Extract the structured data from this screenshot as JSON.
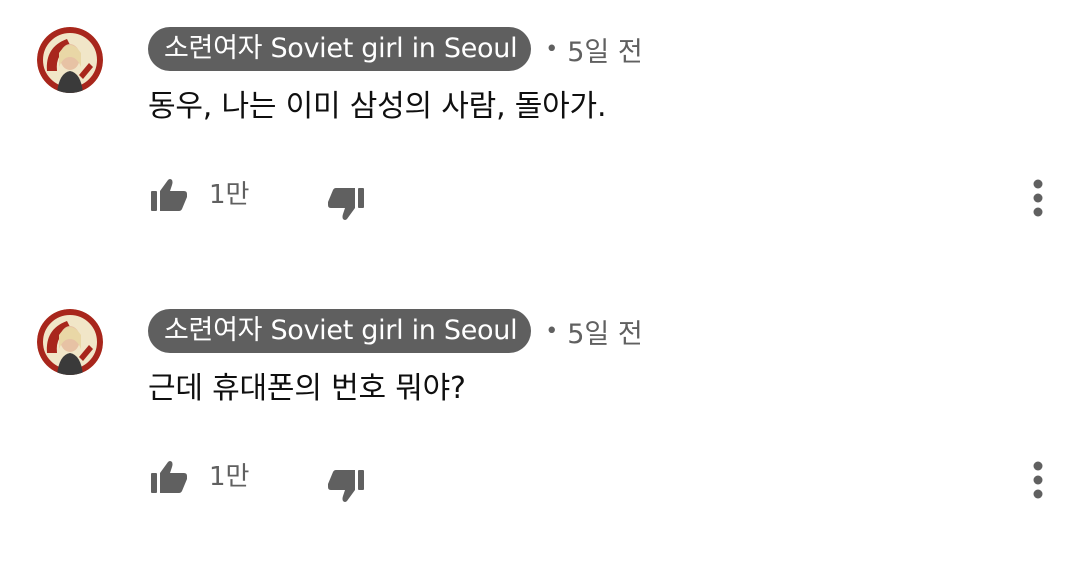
{
  "comments": [
    {
      "author": "소련여자 Soviet girl in Seoul",
      "separator": "•",
      "time": "5일 전",
      "text": "동우, 나는 이미 삼성의 사람, 돌아가.",
      "likes": "1만",
      "avatar_icon": "avatar-image",
      "like_icon": "thumb-up-icon",
      "dislike_icon": "thumb-down-icon",
      "more_icon": "more-vert-icon"
    },
    {
      "author": "소련여자 Soviet girl in Seoul",
      "separator": "•",
      "time": "5일 전",
      "text": "근데 휴대폰의 번호 뭐야?",
      "likes": "1만",
      "avatar_icon": "avatar-image",
      "like_icon": "thumb-up-icon",
      "dislike_icon": "thumb-down-icon",
      "more_icon": "more-vert-icon"
    }
  ],
  "colors": {
    "chip_bg": "#5f5f5f",
    "chip_text": "#ffffff",
    "meta_text": "#606060",
    "body_text": "#0f0f0f",
    "icon": "#606060",
    "avatar_bg": "#f1e6c8",
    "avatar_red": "#a8261c"
  }
}
